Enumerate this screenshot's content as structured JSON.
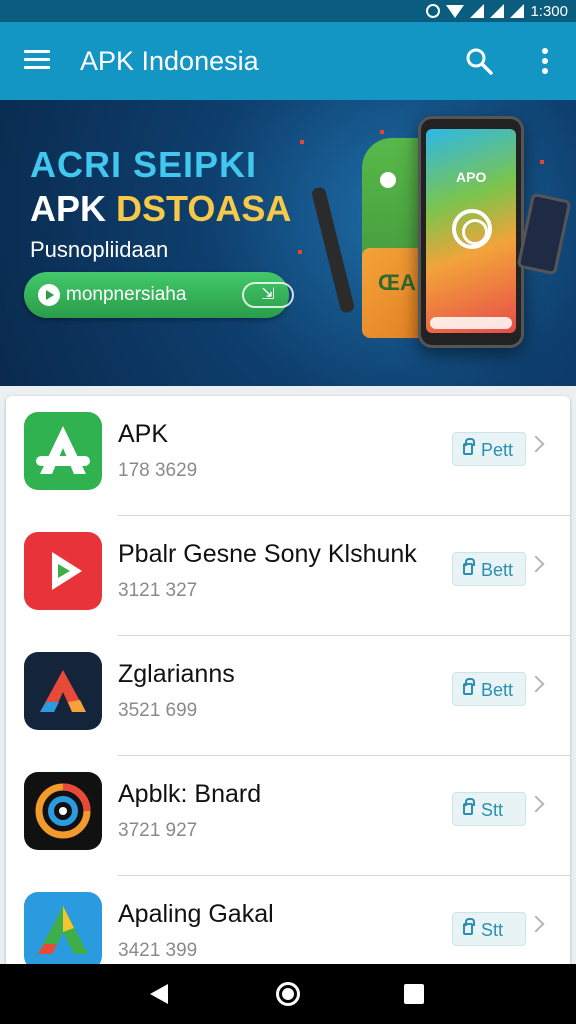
{
  "status_bar": {
    "time": "1:300"
  },
  "app_bar": {
    "title": "APK Indonesia",
    "menu_icon": "hamburger-icon",
    "search_icon": "search-icon",
    "more_icon": "more-vert-icon"
  },
  "banner": {
    "headline_1": "ACRI SEIPKI",
    "headline_2_a": "APK ",
    "headline_2_b": "DSTOASA",
    "subtitle": "Pusnopliidaan",
    "cta_label": "monpnersiaha",
    "phone_title": "APO"
  },
  "apps": [
    {
      "name": "APK",
      "meta": "178 3629",
      "button": "Pett",
      "icon_color": "#2fb24f"
    },
    {
      "name": "Pbalr Gesne Sony Klshunk",
      "meta": "3121 327",
      "button": "Bett",
      "icon_color": "#e8333a"
    },
    {
      "name": "Zglarianns",
      "meta": "3521 699",
      "button": "Bett",
      "icon_color": "#14243a"
    },
    {
      "name": "Apblk: Bnard",
      "meta": "3721 927",
      "button": "Stt",
      "icon_color": "#111111"
    },
    {
      "name": "Apaling Gakal",
      "meta": "3421 399",
      "button": "Stt",
      "icon_color": "#2b9be0"
    }
  ],
  "nav": {
    "back_icon": "back-icon",
    "home_icon": "home-icon",
    "recents_icon": "recents-icon"
  }
}
